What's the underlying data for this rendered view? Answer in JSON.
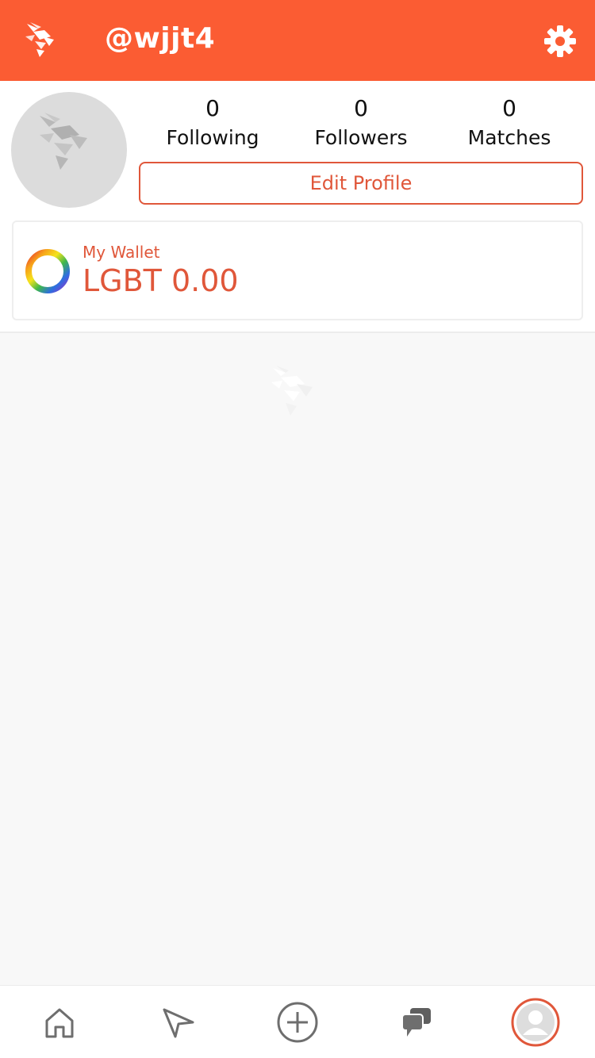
{
  "header": {
    "username": "@wjjt4",
    "logo_icon": "hornet-logo-icon",
    "settings_icon": "gear-icon",
    "background_color": "#fb5c33"
  },
  "profile": {
    "avatar_icon": "hornet-placeholder-icon",
    "stats": [
      {
        "value": "0",
        "label": "Following"
      },
      {
        "value": "0",
        "label": "Followers"
      },
      {
        "value": "0",
        "label": "Matches"
      }
    ],
    "edit_button_label": "Edit Profile",
    "accent_color": "#e0573a"
  },
  "wallet": {
    "icon": "rainbow-ring-icon",
    "label": "My Wallet",
    "balance": "LGBT 0.00"
  },
  "content": {
    "empty_state_icon": "hornet-watermark-icon"
  },
  "tabbar": {
    "tabs": [
      {
        "icon": "home-icon",
        "active": false
      },
      {
        "icon": "explore-arrow-icon",
        "active": false
      },
      {
        "icon": "add-circle-icon",
        "active": false
      },
      {
        "icon": "chat-bubbles-icon",
        "active": false
      },
      {
        "icon": "profile-avatar-icon",
        "active": true
      }
    ]
  }
}
